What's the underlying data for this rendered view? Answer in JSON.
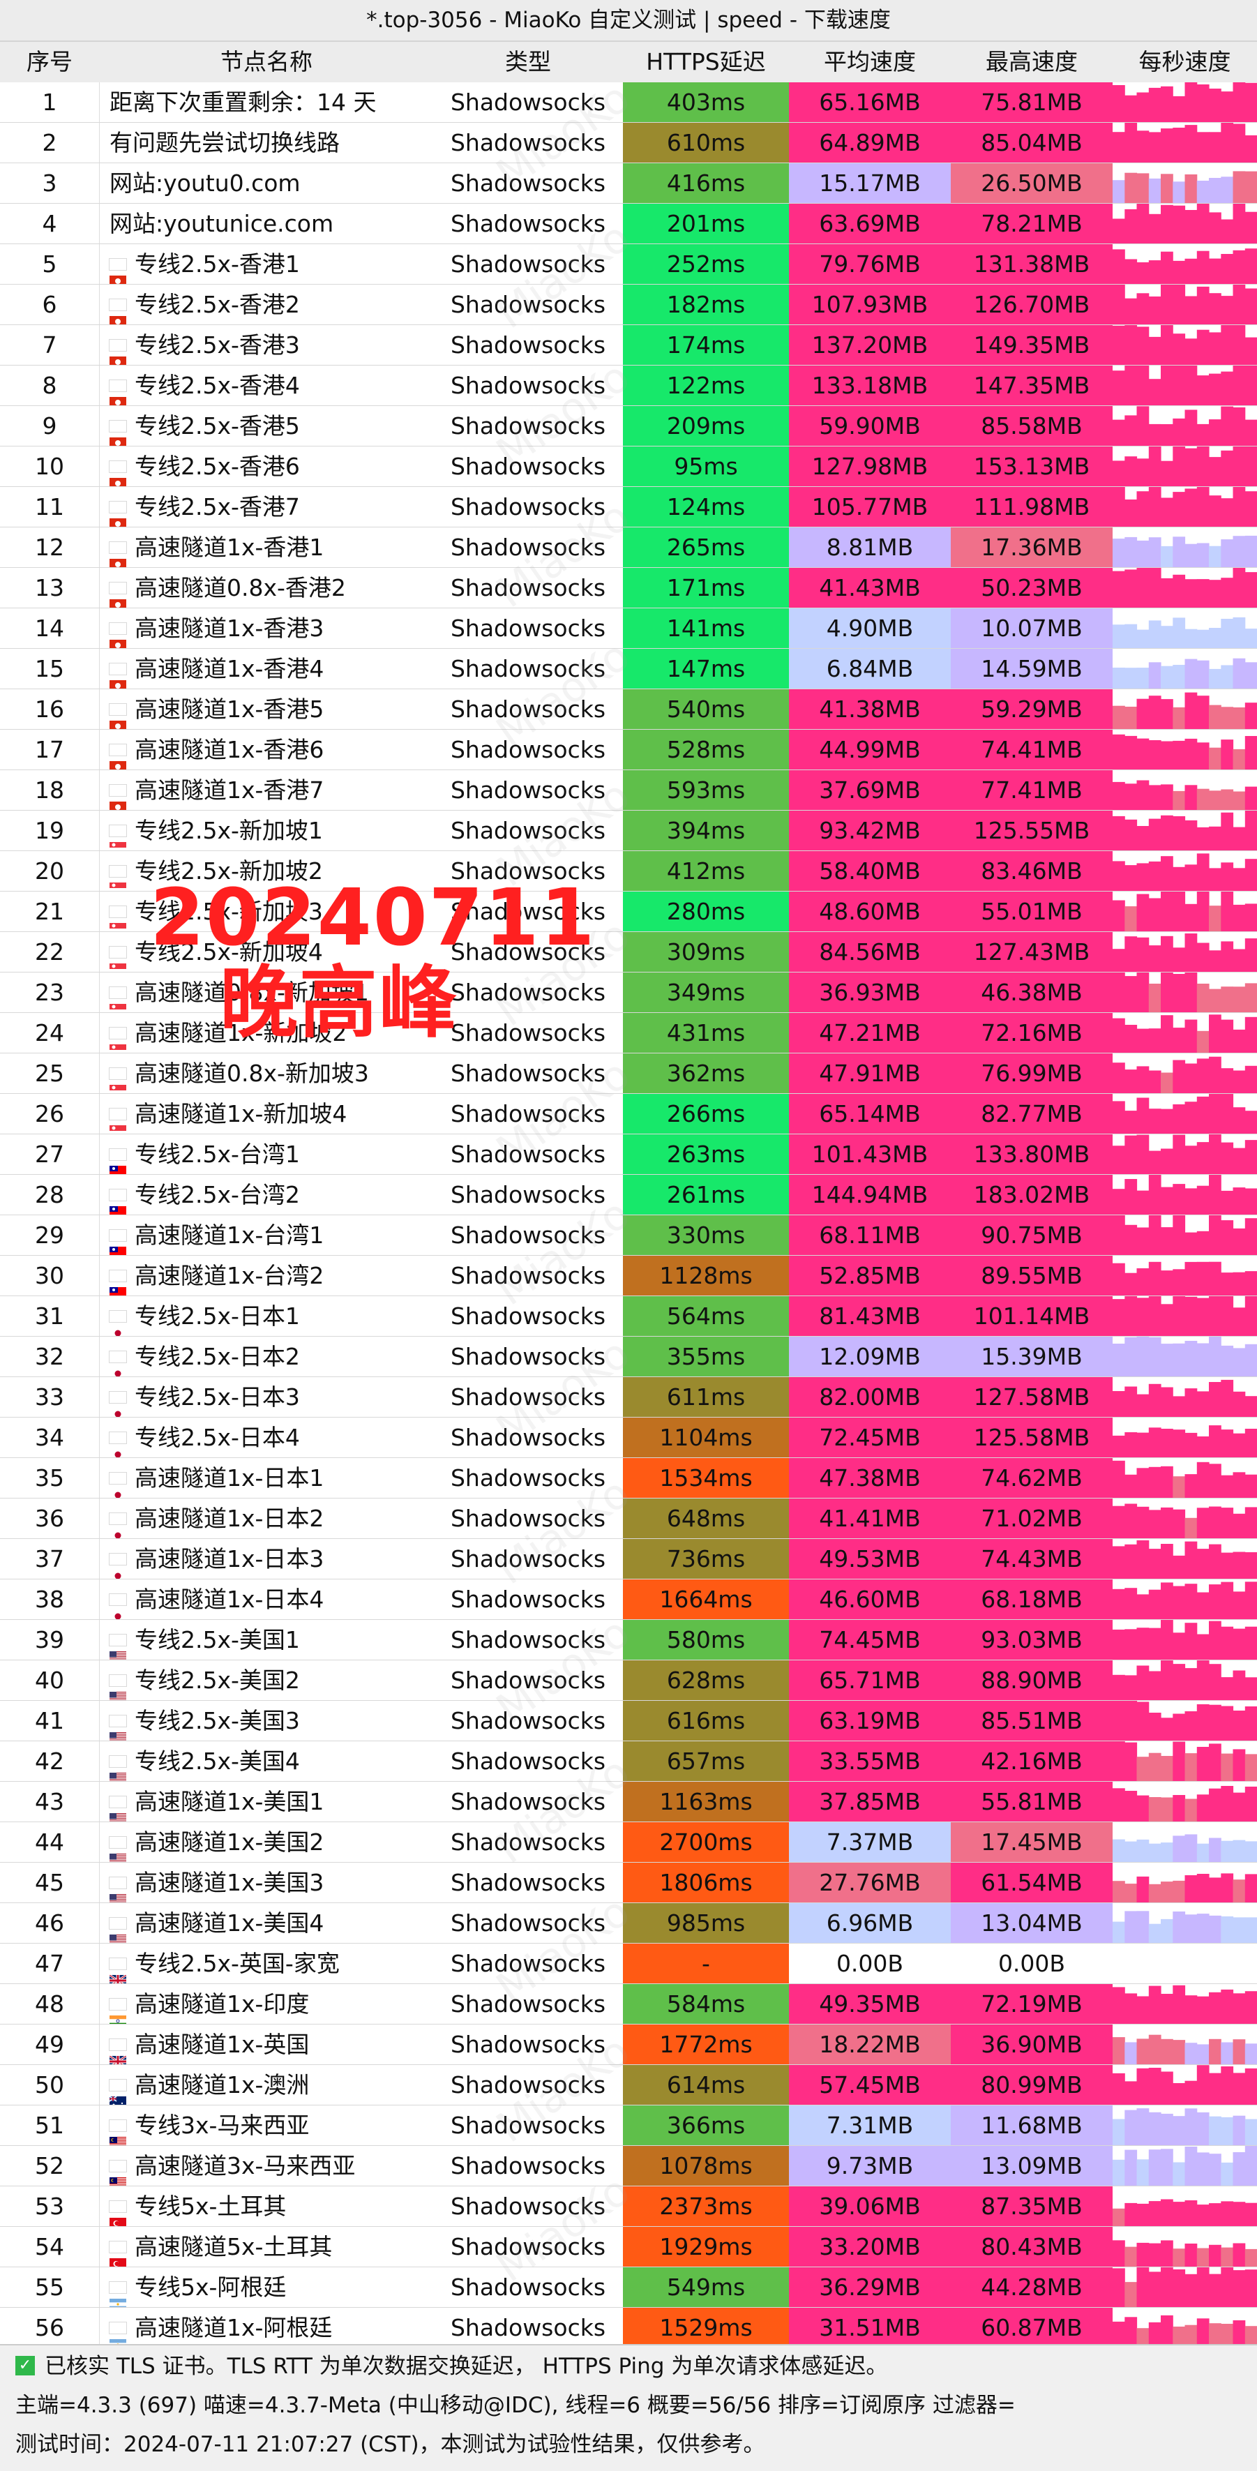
{
  "window": {
    "title": "*.top-3056 - MiaoKo 自定义测试 | speed - 下载速度"
  },
  "columns": [
    "序号",
    "节点名称",
    "类型",
    "HTTPS延迟",
    "平均速度",
    "最高速度",
    "每秒速度"
  ],
  "overlay": {
    "line1": "20240711",
    "line2": "晚高峰"
  },
  "watermark": "MiaoKo",
  "rows": [
    {
      "no": "1",
      "flag": "",
      "name": "距离下次重置剩余：14 天",
      "type": "Shadowsocks",
      "latency": "403ms",
      "avg": "65.16MB",
      "max": "75.81MB"
    },
    {
      "no": "2",
      "flag": "",
      "name": "有问题先尝试切换线路",
      "type": "Shadowsocks",
      "latency": "610ms",
      "avg": "64.89MB",
      "max": "85.04MB"
    },
    {
      "no": "3",
      "flag": "",
      "name": "网站:youtu0.com",
      "type": "Shadowsocks",
      "latency": "416ms",
      "avg": "15.17MB",
      "max": "26.50MB"
    },
    {
      "no": "4",
      "flag": "",
      "name": "网站:youtunice.com",
      "type": "Shadowsocks",
      "latency": "201ms",
      "avg": "63.69MB",
      "max": "78.21MB"
    },
    {
      "no": "5",
      "flag": "hk",
      "name": "专线2.5x-香港1",
      "type": "Shadowsocks",
      "latency": "252ms",
      "avg": "79.76MB",
      "max": "131.38MB"
    },
    {
      "no": "6",
      "flag": "hk",
      "name": "专线2.5x-香港2",
      "type": "Shadowsocks",
      "latency": "182ms",
      "avg": "107.93MB",
      "max": "126.70MB"
    },
    {
      "no": "7",
      "flag": "hk",
      "name": "专线2.5x-香港3",
      "type": "Shadowsocks",
      "latency": "174ms",
      "avg": "137.20MB",
      "max": "149.35MB"
    },
    {
      "no": "8",
      "flag": "hk",
      "name": "专线2.5x-香港4",
      "type": "Shadowsocks",
      "latency": "122ms",
      "avg": "133.18MB",
      "max": "147.35MB"
    },
    {
      "no": "9",
      "flag": "hk",
      "name": "专线2.5x-香港5",
      "type": "Shadowsocks",
      "latency": "209ms",
      "avg": "59.90MB",
      "max": "85.58MB"
    },
    {
      "no": "10",
      "flag": "hk",
      "name": "专线2.5x-香港6",
      "type": "Shadowsocks",
      "latency": "95ms",
      "avg": "127.98MB",
      "max": "153.13MB"
    },
    {
      "no": "11",
      "flag": "hk",
      "name": "专线2.5x-香港7",
      "type": "Shadowsocks",
      "latency": "124ms",
      "avg": "105.77MB",
      "max": "111.98MB"
    },
    {
      "no": "12",
      "flag": "hk",
      "name": "高速隧道1x-香港1",
      "type": "Shadowsocks",
      "latency": "265ms",
      "avg": "8.81MB",
      "max": "17.36MB"
    },
    {
      "no": "13",
      "flag": "hk",
      "name": "高速隧道0.8x-香港2",
      "type": "Shadowsocks",
      "latency": "171ms",
      "avg": "41.43MB",
      "max": "50.23MB"
    },
    {
      "no": "14",
      "flag": "hk",
      "name": "高速隧道1x-香港3",
      "type": "Shadowsocks",
      "latency": "141ms",
      "avg": "4.90MB",
      "max": "10.07MB"
    },
    {
      "no": "15",
      "flag": "hk",
      "name": "高速隧道1x-香港4",
      "type": "Shadowsocks",
      "latency": "147ms",
      "avg": "6.84MB",
      "max": "14.59MB"
    },
    {
      "no": "16",
      "flag": "hk",
      "name": "高速隧道1x-香港5",
      "type": "Shadowsocks",
      "latency": "540ms",
      "avg": "41.38MB",
      "max": "59.29MB"
    },
    {
      "no": "17",
      "flag": "hk",
      "name": "高速隧道1x-香港6",
      "type": "Shadowsocks",
      "latency": "528ms",
      "avg": "44.99MB",
      "max": "74.41MB"
    },
    {
      "no": "18",
      "flag": "hk",
      "name": "高速隧道1x-香港7",
      "type": "Shadowsocks",
      "latency": "593ms",
      "avg": "37.69MB",
      "max": "77.41MB"
    },
    {
      "no": "19",
      "flag": "sg",
      "name": "专线2.5x-新加坡1",
      "type": "Shadowsocks",
      "latency": "394ms",
      "avg": "93.42MB",
      "max": "125.55MB"
    },
    {
      "no": "20",
      "flag": "sg",
      "name": "专线2.5x-新加坡2",
      "type": "Shadowsocks",
      "latency": "412ms",
      "avg": "58.40MB",
      "max": "83.46MB"
    },
    {
      "no": "21",
      "flag": "sg",
      "name": "专线2.5x-新加坡3",
      "type": "Shadowsocks",
      "latency": "280ms",
      "avg": "48.60MB",
      "max": "55.01MB"
    },
    {
      "no": "22",
      "flag": "sg",
      "name": "专线2.5x-新加坡4",
      "type": "Shadowsocks",
      "latency": "309ms",
      "avg": "84.56MB",
      "max": "127.43MB"
    },
    {
      "no": "23",
      "flag": "sg",
      "name": "高速隧道0.8x-新加坡1",
      "type": "Shadowsocks",
      "latency": "349ms",
      "avg": "36.93MB",
      "max": "46.38MB"
    },
    {
      "no": "24",
      "flag": "sg",
      "name": "高速隧道1x-新加坡2",
      "type": "Shadowsocks",
      "latency": "431ms",
      "avg": "47.21MB",
      "max": "72.16MB"
    },
    {
      "no": "25",
      "flag": "sg",
      "name": "高速隧道0.8x-新加坡3",
      "type": "Shadowsocks",
      "latency": "362ms",
      "avg": "47.91MB",
      "max": "76.99MB"
    },
    {
      "no": "26",
      "flag": "sg",
      "name": "高速隧道1x-新加坡4",
      "type": "Shadowsocks",
      "latency": "266ms",
      "avg": "65.14MB",
      "max": "82.77MB"
    },
    {
      "no": "27",
      "flag": "tw",
      "name": "专线2.5x-台湾1",
      "type": "Shadowsocks",
      "latency": "263ms",
      "avg": "101.43MB",
      "max": "133.80MB"
    },
    {
      "no": "28",
      "flag": "tw",
      "name": "专线2.5x-台湾2",
      "type": "Shadowsocks",
      "latency": "261ms",
      "avg": "144.94MB",
      "max": "183.02MB"
    },
    {
      "no": "29",
      "flag": "tw",
      "name": "高速隧道1x-台湾1",
      "type": "Shadowsocks",
      "latency": "330ms",
      "avg": "68.11MB",
      "max": "90.75MB"
    },
    {
      "no": "30",
      "flag": "tw",
      "name": "高速隧道1x-台湾2",
      "type": "Shadowsocks",
      "latency": "1128ms",
      "avg": "52.85MB",
      "max": "89.55MB"
    },
    {
      "no": "31",
      "flag": "jp",
      "name": "专线2.5x-日本1",
      "type": "Shadowsocks",
      "latency": "564ms",
      "avg": "81.43MB",
      "max": "101.14MB"
    },
    {
      "no": "32",
      "flag": "jp",
      "name": "专线2.5x-日本2",
      "type": "Shadowsocks",
      "latency": "355ms",
      "avg": "12.09MB",
      "max": "15.39MB"
    },
    {
      "no": "33",
      "flag": "jp",
      "name": "专线2.5x-日本3",
      "type": "Shadowsocks",
      "latency": "611ms",
      "avg": "82.00MB",
      "max": "127.58MB"
    },
    {
      "no": "34",
      "flag": "jp",
      "name": "专线2.5x-日本4",
      "type": "Shadowsocks",
      "latency": "1104ms",
      "avg": "72.45MB",
      "max": "125.58MB"
    },
    {
      "no": "35",
      "flag": "jp",
      "name": "高速隧道1x-日本1",
      "type": "Shadowsocks",
      "latency": "1534ms",
      "avg": "47.38MB",
      "max": "74.62MB"
    },
    {
      "no": "36",
      "flag": "jp",
      "name": "高速隧道1x-日本2",
      "type": "Shadowsocks",
      "latency": "648ms",
      "avg": "41.41MB",
      "max": "71.02MB"
    },
    {
      "no": "37",
      "flag": "jp",
      "name": "高速隧道1x-日本3",
      "type": "Shadowsocks",
      "latency": "736ms",
      "avg": "49.53MB",
      "max": "74.43MB"
    },
    {
      "no": "38",
      "flag": "jp",
      "name": "高速隧道1x-日本4",
      "type": "Shadowsocks",
      "latency": "1664ms",
      "avg": "46.60MB",
      "max": "68.18MB"
    },
    {
      "no": "39",
      "flag": "us",
      "name": "专线2.5x-美国1",
      "type": "Shadowsocks",
      "latency": "580ms",
      "avg": "74.45MB",
      "max": "93.03MB"
    },
    {
      "no": "40",
      "flag": "us",
      "name": "专线2.5x-美国2",
      "type": "Shadowsocks",
      "latency": "628ms",
      "avg": "65.71MB",
      "max": "88.90MB"
    },
    {
      "no": "41",
      "flag": "us",
      "name": "专线2.5x-美国3",
      "type": "Shadowsocks",
      "latency": "616ms",
      "avg": "63.19MB",
      "max": "85.51MB"
    },
    {
      "no": "42",
      "flag": "us",
      "name": "专线2.5x-美国4",
      "type": "Shadowsocks",
      "latency": "657ms",
      "avg": "33.55MB",
      "max": "42.16MB"
    },
    {
      "no": "43",
      "flag": "us",
      "name": "高速隧道1x-美国1",
      "type": "Shadowsocks",
      "latency": "1163ms",
      "avg": "37.85MB",
      "max": "55.81MB"
    },
    {
      "no": "44",
      "flag": "us",
      "name": "高速隧道1x-美国2",
      "type": "Shadowsocks",
      "latency": "2700ms",
      "avg": "7.37MB",
      "max": "17.45MB"
    },
    {
      "no": "45",
      "flag": "us",
      "name": "高速隧道1x-美国3",
      "type": "Shadowsocks",
      "latency": "1806ms",
      "avg": "27.76MB",
      "max": "61.54MB"
    },
    {
      "no": "46",
      "flag": "us",
      "name": "高速隧道1x-美国4",
      "type": "Shadowsocks",
      "latency": "985ms",
      "avg": "6.96MB",
      "max": "13.04MB"
    },
    {
      "no": "47",
      "flag": "gb",
      "name": "专线2.5x-英国-家宽",
      "type": "Shadowsocks",
      "latency": "-",
      "avg": "0.00B",
      "max": "0.00B"
    },
    {
      "no": "48",
      "flag": "in",
      "name": "高速隧道1x-印度",
      "type": "Shadowsocks",
      "latency": "584ms",
      "avg": "49.35MB",
      "max": "72.19MB"
    },
    {
      "no": "49",
      "flag": "gb",
      "name": "高速隧道1x-英国",
      "type": "Shadowsocks",
      "latency": "1772ms",
      "avg": "18.22MB",
      "max": "36.90MB"
    },
    {
      "no": "50",
      "flag": "au",
      "name": "高速隧道1x-澳洲",
      "type": "Shadowsocks",
      "latency": "614ms",
      "avg": "57.45MB",
      "max": "80.99MB"
    },
    {
      "no": "51",
      "flag": "my",
      "name": "专线3x-马来西亚",
      "type": "Shadowsocks",
      "latency": "366ms",
      "avg": "7.31MB",
      "max": "11.68MB"
    },
    {
      "no": "52",
      "flag": "my",
      "name": "高速隧道3x-马来西亚",
      "type": "Shadowsocks",
      "latency": "1078ms",
      "avg": "9.73MB",
      "max": "13.09MB"
    },
    {
      "no": "53",
      "flag": "tr",
      "name": "专线5x-土耳其",
      "type": "Shadowsocks",
      "latency": "2373ms",
      "avg": "39.06MB",
      "max": "87.35MB"
    },
    {
      "no": "54",
      "flag": "tr",
      "name": "高速隧道5x-土耳其",
      "type": "Shadowsocks",
      "latency": "1929ms",
      "avg": "33.20MB",
      "max": "80.43MB"
    },
    {
      "no": "55",
      "flag": "ar",
      "name": "专线5x-阿根廷",
      "type": "Shadowsocks",
      "latency": "549ms",
      "avg": "36.29MB",
      "max": "44.28MB"
    },
    {
      "no": "56",
      "flag": "ar",
      "name": "高速隧道1x-阿根廷",
      "type": "Shadowsocks",
      "latency": "1529ms",
      "avg": "31.51MB",
      "max": "60.87MB"
    }
  ],
  "footer": {
    "line1": "已核实 TLS 证书。TLS RTT 为单次数据交换延迟， HTTPS Ping 为单次请求体感延迟。",
    "line2": "主端=4.3.3 (697) 喵速=4.3.7-Meta (中山移动@IDC), 线程=6 概要=56/56 排序=订阅原序 过滤器=",
    "line3": "测试时间：2024-07-11 21:07:27 (CST)，本测试为试验性结果，仅供参考。"
  },
  "colors": {
    "latency_fast": "#17e86a",
    "latency_medium": "#5fbf4a",
    "latency_slow": "#9a8a2e",
    "latency_slower": "#c0701f",
    "latency_very_slow": "#ff5a14",
    "speed_high": "#ff2d86",
    "speed_mid": "#f0708a",
    "speed_low": "#c7b7ff",
    "speed_very_low": "#c2d2ff",
    "overlay_text": "#ff2020",
    "check_green": "#2fb84a"
  }
}
